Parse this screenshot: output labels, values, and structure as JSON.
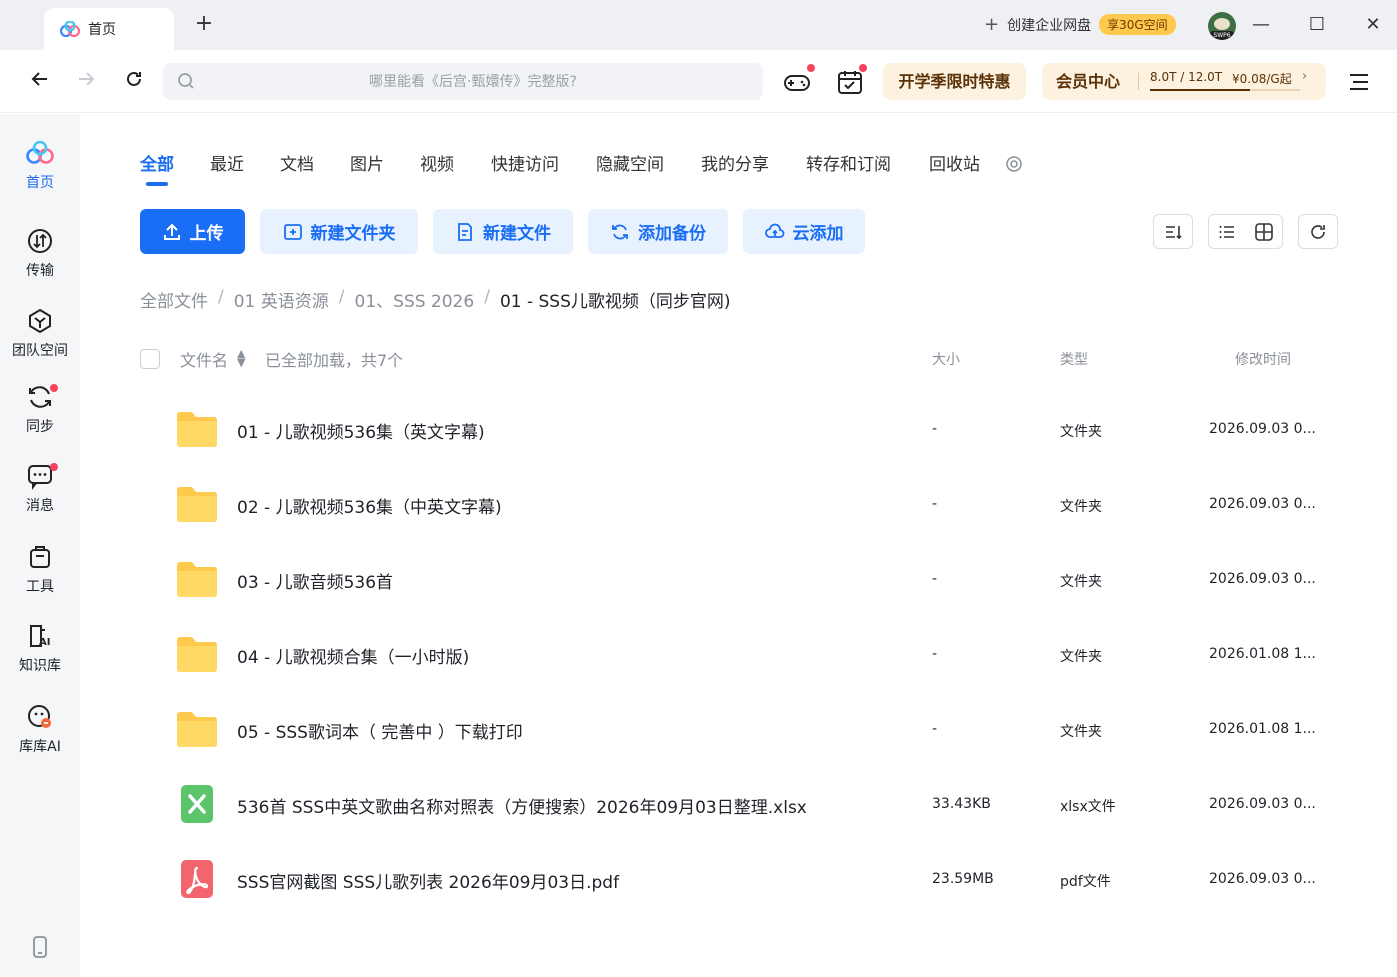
{
  "window": {
    "tab_label": "首页",
    "create_enterprise": "创建企业网盘",
    "enterprise_badge": "享30G空间",
    "avatar_tag": "SWP6"
  },
  "toolbar": {
    "search_placeholder": "哪里能看《后宫·甄嬛传》完整版?",
    "promo_label": "开学季限时特惠",
    "member_title": "会员中心",
    "member_quota": "8.0T / 12.0T",
    "member_price": "¥0.08/G起",
    "quota_fraction": 0.667
  },
  "sidebar": {
    "items": [
      {
        "label": "首页"
      },
      {
        "label": "传输"
      },
      {
        "label": "团队空间"
      },
      {
        "label": "同步"
      },
      {
        "label": "消息"
      },
      {
        "label": "工具"
      },
      {
        "label": "知识库"
      },
      {
        "label": "库库AI"
      }
    ]
  },
  "categories": [
    "全部",
    "最近",
    "文档",
    "图片",
    "视频",
    "快捷访问",
    "隐藏空间",
    "我的分享",
    "转存和订阅",
    "回收站"
  ],
  "actions": {
    "upload": "上传",
    "new_folder": "新建文件夹",
    "new_file": "新建文件",
    "add_backup": "添加备份",
    "cloud_add": "云添加"
  },
  "breadcrumb": [
    "全部文件",
    "01 英语资源",
    "01、SSS 2026",
    "01 - SSS儿歌视频（同步官网)"
  ],
  "table": {
    "col_name": "文件名",
    "loaded_status": "已全部加载，共7个",
    "col_size": "大小",
    "col_type": "类型",
    "col_time": "修改时间"
  },
  "files": [
    {
      "name": "01 - 儿歌视频536集（英文字幕)",
      "size": "-",
      "type": "文件夹",
      "time": "2026.09.03 0...",
      "icon": "folder"
    },
    {
      "name": "02 - 儿歌视频536集（中英文字幕)",
      "size": "-",
      "type": "文件夹",
      "time": "2026.09.03 0...",
      "icon": "folder"
    },
    {
      "name": "03 - 儿歌音频536首",
      "size": "-",
      "type": "文件夹",
      "time": "2026.09.03 0...",
      "icon": "folder"
    },
    {
      "name": "04 - 儿歌视频合集（一小时版)",
      "size": "-",
      "type": "文件夹",
      "time": "2026.01.08 1...",
      "icon": "folder"
    },
    {
      "name": "05 - SSS歌词本（ 完善中 ）下载打印",
      "size": "-",
      "type": "文件夹",
      "time": "2026.01.08 1...",
      "icon": "folder"
    },
    {
      "name": "536首 SSS中英文歌曲名称对照表（方便搜索）2026年09月03日整理.xlsx",
      "size": "33.43KB",
      "type": "xlsx文件",
      "time": "2026.09.03 0...",
      "icon": "xlsx"
    },
    {
      "name": "SSS官网截图 SSS儿歌列表 2026年09月03日.pdf",
      "size": "23.59MB",
      "type": "pdf文件",
      "time": "2026.09.03 0...",
      "icon": "pdf"
    }
  ],
  "colors": {
    "accent": "#1a6ef5",
    "folder": "#ffc94d",
    "xlsx": "#5cc46a",
    "pdf": "#f2646e",
    "notification": "#f5425d"
  }
}
